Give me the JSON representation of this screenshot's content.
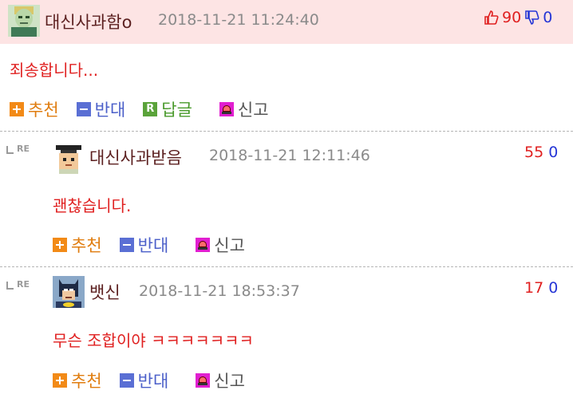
{
  "comments": [
    {
      "nickname": "대신사과함o",
      "timestamp": "2018-11-21 11:24:40",
      "content": "죄송합니다...",
      "upvotes": "90",
      "downvotes": "0",
      "actions": {
        "recommend": "추천",
        "oppose": "반대",
        "reply": "답글",
        "report": "신고"
      }
    },
    {
      "re_label": "RE",
      "nickname": "대신사과받음",
      "timestamp": "2018-11-21 12:11:46",
      "content": "괜찮습니다.",
      "upvotes": "55",
      "downvotes": "0",
      "actions": {
        "recommend": "추천",
        "oppose": "반대",
        "report": "신고"
      }
    },
    {
      "re_label": "RE",
      "nickname": "뱃신",
      "timestamp": "2018-11-21 18:53:37",
      "content": "무슨 조합이야 ㅋㅋㅋㅋㅋㅋㅋ",
      "upvotes": "17",
      "downvotes": "0",
      "actions": {
        "recommend": "추천",
        "oppose": "반대",
        "report": "신고"
      }
    }
  ],
  "reply_icon_letter": "R",
  "icons": [
    "thumbs-up-icon",
    "thumbs-down-icon",
    "recommend-plus-icon",
    "oppose-minus-icon",
    "reply-icon",
    "report-siren-icon",
    "reply-arrow-icon"
  ],
  "colors": {
    "header_bg": "#fde4e4",
    "upvote": "#e02020",
    "downvote": "#2636d6",
    "content": "#e02020"
  }
}
